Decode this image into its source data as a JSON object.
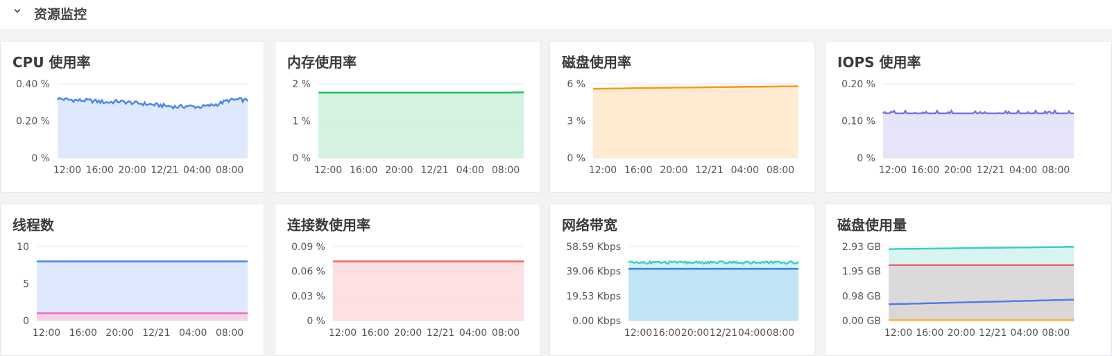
{
  "section": {
    "title": "资源监控",
    "icon": "chevron-down-icon"
  },
  "charts": [
    {
      "id": "cpu",
      "title": "CPU 使用率",
      "type": "area",
      "x_ticks": [
        "12:00",
        "16:00",
        "20:00",
        "12/21",
        "04:00",
        "08:00"
      ],
      "y_ticks": [
        "0 %",
        "0.20 %",
        "0.40 %"
      ],
      "ylim": [
        0,
        0.4
      ],
      "series": [
        {
          "color": "#4c85ee",
          "fill": "#dbe7fd",
          "noise": 0.01,
          "values": [
            0.32,
            0.315,
            0.31,
            0.31,
            0.305,
            0.3,
            0.305,
            0.3,
            0.295,
            0.29,
            0.285,
            0.28,
            0.275,
            0.28,
            0.275,
            0.28,
            0.29,
            0.31,
            0.315,
            0.31
          ]
        }
      ]
    },
    {
      "id": "memory",
      "title": "内存使用率",
      "type": "area",
      "x_ticks": [
        "12:00",
        "16:00",
        "20:00",
        "12/21",
        "04:00",
        "08:00"
      ],
      "y_ticks": [
        "0 %",
        "1 %",
        "2 %"
      ],
      "ylim": [
        0,
        2
      ],
      "series": [
        {
          "color": "#1ebd5c",
          "fill": "#d0f1de",
          "noise": 0,
          "values": [
            1.76,
            1.76,
            1.76,
            1.76,
            1.76,
            1.76,
            1.76,
            1.76,
            1.76,
            1.77
          ]
        }
      ]
    },
    {
      "id": "disk-rate",
      "title": "磁盘使用率",
      "type": "area",
      "x_ticks": [
        "12:00",
        "16:00",
        "20:00",
        "12/21",
        "04:00",
        "08:00"
      ],
      "y_ticks": [
        "0 %",
        "3 %",
        "6 %"
      ],
      "ylim": [
        0,
        6
      ],
      "series": [
        {
          "color": "#f59a13",
          "fill": "#fee9cc",
          "noise": 0,
          "values": [
            5.6,
            5.62,
            5.65,
            5.68,
            5.7,
            5.72,
            5.74,
            5.76,
            5.78,
            5.8
          ]
        }
      ]
    },
    {
      "id": "iops",
      "title": "IOPS 使用率",
      "type": "area",
      "x_ticks": [
        "12:00",
        "16:00",
        "20:00",
        "12/21",
        "04:00",
        "08:00"
      ],
      "y_ticks": [
        "0 %",
        "0.10 %",
        "0.20 %"
      ],
      "ylim": [
        0,
        0.2
      ],
      "series": [
        {
          "color": "#7a72de",
          "fill": "#e3e1f8",
          "noise": 0,
          "spikes": 0.008,
          "values": [
            0.12,
            0.12,
            0.12,
            0.12,
            0.12,
            0.12,
            0.12,
            0.12,
            0.12,
            0.12
          ]
        }
      ]
    },
    {
      "id": "threads",
      "title": "线程数",
      "type": "area",
      "x_ticks": [
        "12:00",
        "16:00",
        "20:00",
        "12/21",
        "04:00",
        "08:00"
      ],
      "y_ticks": [
        "0",
        "5",
        "10"
      ],
      "ylim": [
        0,
        10
      ],
      "series": [
        {
          "color": "#4c85ee",
          "fill": "#dbe7fd",
          "noise": 0,
          "values": [
            8,
            8,
            8,
            8,
            8,
            8,
            8,
            8,
            8,
            8
          ]
        },
        {
          "color": "#ec6fbd",
          "fill": "#f7d2e6",
          "noise": 0,
          "values": [
            1,
            1,
            1,
            1,
            1,
            1,
            1,
            1,
            1,
            1
          ]
        }
      ]
    },
    {
      "id": "connections",
      "title": "连接数使用率",
      "type": "area",
      "x_ticks": [
        "12:00",
        "16:00",
        "20:00",
        "12/21",
        "04:00",
        "08:00"
      ],
      "y_ticks": [
        "0 %",
        "0.03 %",
        "0.06 %",
        "0.09 %"
      ],
      "ylim": [
        0,
        0.09
      ],
      "series": [
        {
          "color": "#ee6666",
          "fill": "#fdddde",
          "noise": 0,
          "values": [
            0.072,
            0.072,
            0.072,
            0.072,
            0.072,
            0.072,
            0.072,
            0.072,
            0.072,
            0.072
          ]
        }
      ]
    },
    {
      "id": "network",
      "title": "网络带宽",
      "type": "area",
      "x_ticks": [
        "12:00",
        "16:00",
        "20:00",
        "12/21",
        "04:00",
        "08:00"
      ],
      "y_ticks": [
        "0.00 Kbps",
        "19.53 Kbps",
        "39.06 Kbps",
        "58.59 Kbps"
      ],
      "ylim": [
        0,
        58.59
      ],
      "series": [
        {
          "color": "#3ccfc0",
          "fill": "#cdf2ee",
          "noise": 0.9,
          "values": [
            46,
            46,
            46,
            46,
            46,
            46,
            46,
            46,
            46,
            46
          ]
        },
        {
          "color": "#3e7ee0",
          "fill": "#bde3f5",
          "noise": 0,
          "values": [
            41,
            41,
            41,
            41,
            41,
            41,
            41,
            41,
            41,
            41
          ]
        }
      ]
    },
    {
      "id": "disk-usage",
      "title": "磁盘使用量",
      "type": "area",
      "x_ticks": [
        "12:00",
        "16:00",
        "20:00",
        "12/21",
        "04:00",
        "08:00"
      ],
      "y_ticks": [
        "0.00 GB",
        "0.98 GB",
        "1.95 GB",
        "2.93 GB"
      ],
      "ylim": [
        0,
        2.93
      ],
      "series": [
        {
          "color": "#3ccfc0",
          "fill": "#d4f3ef",
          "noise": 0,
          "values": [
            2.83,
            2.84,
            2.85,
            2.86,
            2.87,
            2.88,
            2.89,
            2.9,
            2.91,
            2.92
          ]
        },
        {
          "color": "#ee6666",
          "fill": "#dcd6d6",
          "noise": 0,
          "values": [
            2.2,
            2.2,
            2.2,
            2.2,
            2.2,
            2.2,
            2.2,
            2.2,
            2.2,
            2.2
          ]
        },
        {
          "color": "#4c7ee8",
          "fill": "#dcd6d6",
          "noise": 0,
          "values": [
            0.65,
            0.67,
            0.69,
            0.71,
            0.73,
            0.75,
            0.77,
            0.79,
            0.81,
            0.83
          ]
        },
        {
          "color": "#f5b83d",
          "fill": "none",
          "noise": 0,
          "values": [
            0.02,
            0.02,
            0.02,
            0.02,
            0.02,
            0.02,
            0.02,
            0.02,
            0.02,
            0.02
          ]
        }
      ]
    }
  ]
}
